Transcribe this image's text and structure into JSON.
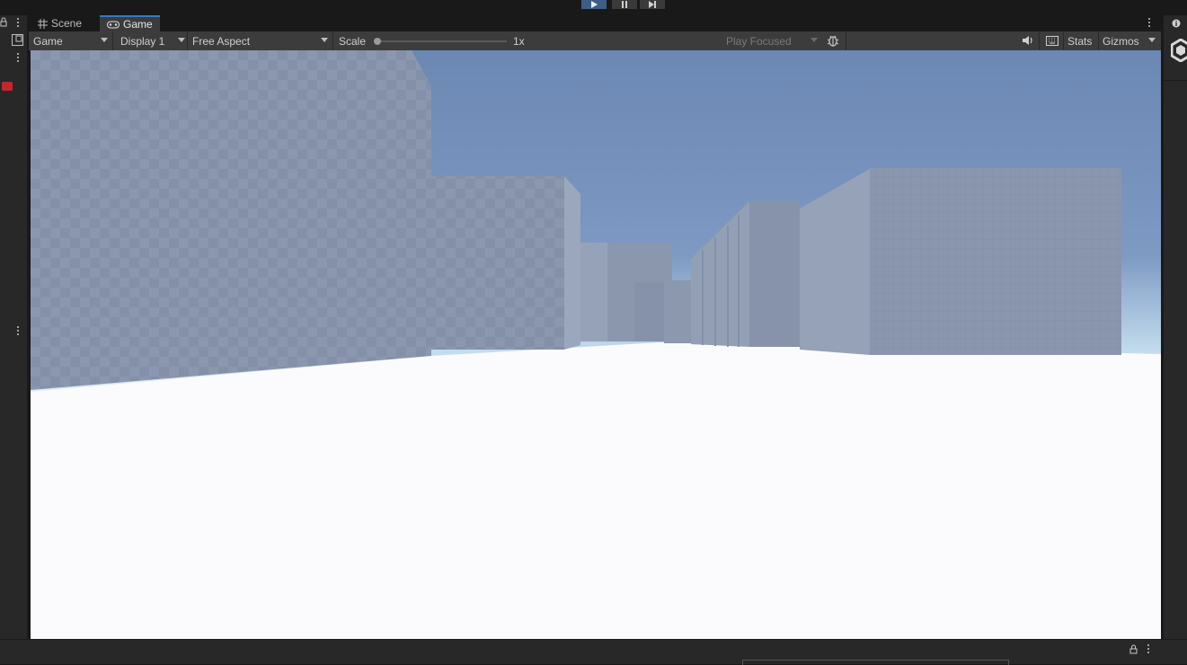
{
  "app": {
    "accent": "#3a79bb"
  },
  "tabs": [
    {
      "label": "Scene",
      "icon": "grid-icon"
    },
    {
      "label": "Game",
      "icon": "gamepad-icon"
    }
  ],
  "toolbar": {
    "view_mode": "Game",
    "display": "Display 1",
    "aspect": "Free Aspect",
    "scale_label": "Scale",
    "scale_value": "1x",
    "scale_fraction": 0.0,
    "play_mode": "Play Focused",
    "stats_label": "Stats",
    "gizmos_label": "Gizmos"
  },
  "icons": {
    "play": "play-icon",
    "pause": "pause-icon",
    "step": "step-icon",
    "bug": "bug-icon",
    "audio": "speaker-icon",
    "resolution": "keyboard-icon",
    "lock": "lock-icon",
    "info": "info-icon",
    "unity": "unity-logo-icon"
  },
  "scene_colors": {
    "sky_top": "#6c88b4",
    "sky_horizon": "#e3f1fb",
    "ground": "#fbfbfd",
    "wall_front": "#8593aa",
    "wall_side": "#98a6bd"
  }
}
